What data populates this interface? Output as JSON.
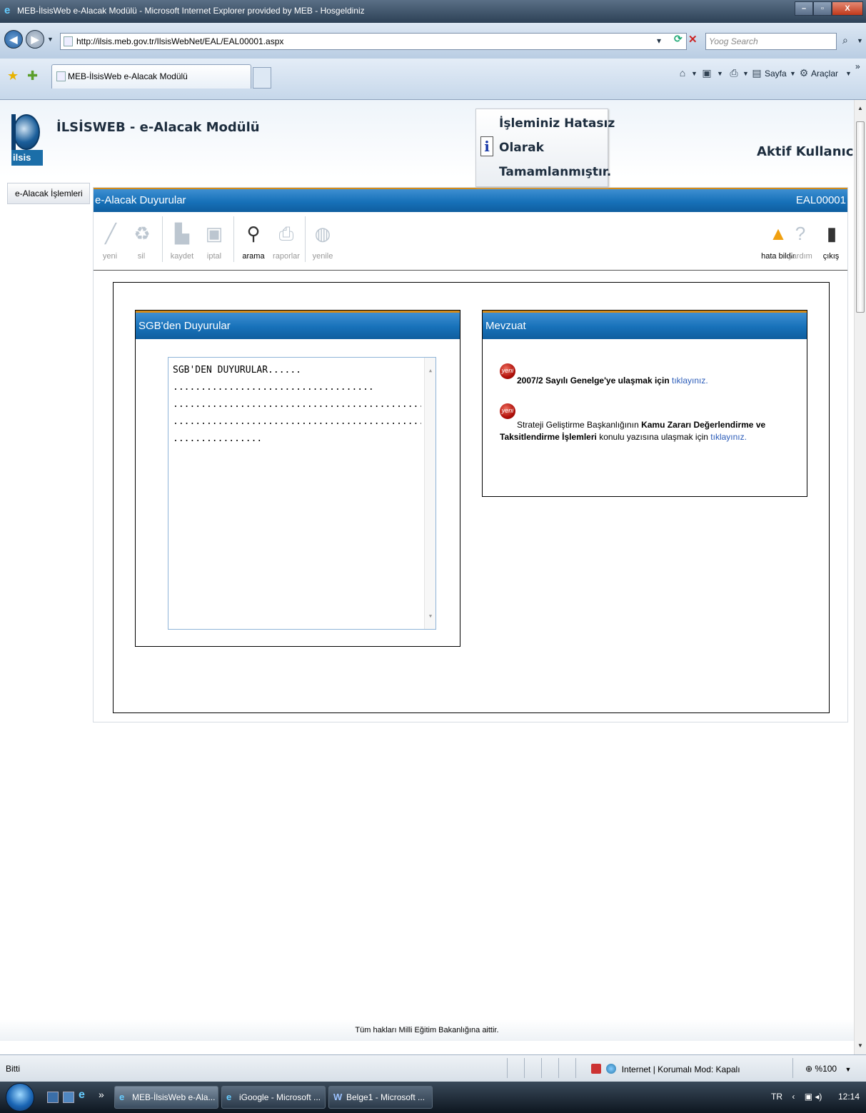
{
  "window": {
    "title": "MEB-İlsisWeb e-Alacak Modülü - Microsoft Internet Explorer provided by MEB - Hosgeldiniz",
    "address": "http://ilsis.meb.gov.tr/IlsisWebNet/EAL/EAL00001.aspx",
    "search_placeholder": "Yoog Search",
    "tab_label": "MEB-İlsisWeb e-Alacak Modülü",
    "cmd_page": "Sayfa",
    "cmd_tools": "Araçlar",
    "more_chevron": "»"
  },
  "header": {
    "logo_text": "ilsis",
    "app_title": "İLSİSWEB - e-Alacak Modülü",
    "active_user_label": "Aktif Kullanıcı:"
  },
  "message": {
    "line1": "İşleminiz Hatasız",
    "line2": "Olarak",
    "line3": "Tamamlanmıştır.",
    "icon": "i"
  },
  "sidebar": {
    "items": [
      {
        "label": "e-Alacak İşlemleri"
      }
    ]
  },
  "content": {
    "title": "e-Alacak Duyurular",
    "code": "EAL00001"
  },
  "toolbar": {
    "items": [
      {
        "label": "yeni",
        "icon": "pencil-icon",
        "enabled": false
      },
      {
        "label": "sil",
        "icon": "recycle-bin-icon",
        "enabled": false
      },
      {
        "label": "kaydet",
        "icon": "floppy-disk-icon",
        "enabled": false
      },
      {
        "label": "iptal",
        "icon": "monitor-icon",
        "enabled": false
      },
      {
        "label": "arama",
        "icon": "magnifier-icon",
        "enabled": true
      },
      {
        "label": "raporlar",
        "icon": "printer-icon",
        "enabled": false
      },
      {
        "label": "yenile",
        "icon": "globe-icon",
        "enabled": false
      },
      {
        "label": "hata bildir",
        "icon": "warning-icon",
        "enabled": true
      },
      {
        "label": "yardım",
        "icon": "help-icon",
        "enabled": false
      },
      {
        "label": "çıkış",
        "icon": "exit-door-icon",
        "enabled": true
      }
    ]
  },
  "sgb_panel": {
    "title": "SGB'den Duyurular",
    "lines": [
      "SGB'DEN DUYURULAR......",
      "....................................",
      "..........................................................................",
      "..........................................................................",
      "................"
    ]
  },
  "mevzuat_panel": {
    "title": "Mevzuat",
    "badge": "yeni",
    "item1": {
      "bold": "2007/2 Sayılı Genelge'ye ulaşmak için",
      "link": "tıklayınız."
    },
    "item2": {
      "pre": "Strateji Geliştirme Başkanlığının",
      "bold": "Kamu Zararı Değerlendirme ve Taksitlendirme İşlemleri",
      "post": "konulu yazısına ulaşmak için",
      "link": "tıklayınız."
    }
  },
  "footer": {
    "text": "Tüm hakları Milli Eğitim Bakanlığına aittir."
  },
  "statusbar": {
    "status": "Bitti",
    "zone": "Internet | Korumalı Mod: Kapalı",
    "zoom": "%100"
  },
  "taskbar": {
    "buttons": [
      {
        "label": "MEB-İlsisWeb e-Ala..."
      },
      {
        "label": "iGoogle - Microsoft ..."
      },
      {
        "label": "Belge1 - Microsoft ..."
      }
    ],
    "lang": "TR",
    "clock": "12:14"
  }
}
